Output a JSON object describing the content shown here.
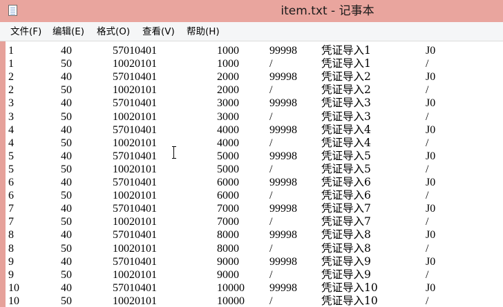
{
  "window": {
    "title": "item.txt - 记事本"
  },
  "menu": [
    "文件(F)",
    "编辑(E)",
    "格式(O)",
    "查看(V)",
    "帮助(H)"
  ],
  "rows": [
    [
      "1",
      "40",
      "57010401",
      "1000",
      "99998",
      "凭证导入1",
      "J0"
    ],
    [
      "1",
      "50",
      "10020101",
      "1000",
      "/",
      "凭证导入1",
      "/"
    ],
    [
      "2",
      "40",
      "57010401",
      "2000",
      "99998",
      "凭证导入2",
      "J0"
    ],
    [
      "2",
      "50",
      "10020101",
      "2000",
      "/",
      "凭证导入2",
      "/"
    ],
    [
      "3",
      "40",
      "57010401",
      "3000",
      "99998",
      "凭证导入3",
      "J0"
    ],
    [
      "3",
      "50",
      "10020101",
      "3000",
      "/",
      "凭证导入3",
      "/"
    ],
    [
      "4",
      "40",
      "57010401",
      "4000",
      "99998",
      "凭证导入4",
      "J0"
    ],
    [
      "4",
      "50",
      "10020101",
      "4000",
      "/",
      "凭证导入4",
      "/"
    ],
    [
      "5",
      "40",
      "57010401",
      "5000",
      "99998",
      "凭证导入5",
      "J0"
    ],
    [
      "5",
      "50",
      "10020101",
      "5000",
      "/",
      "凭证导入5",
      "/"
    ],
    [
      "6",
      "40",
      "57010401",
      "6000",
      "99998",
      "凭证导入6",
      "J0"
    ],
    [
      "6",
      "50",
      "10020101",
      "6000",
      "/",
      "凭证导入6",
      "/"
    ],
    [
      "7",
      "40",
      "57010401",
      "7000",
      "99998",
      "凭证导入7",
      "J0"
    ],
    [
      "7",
      "50",
      "10020101",
      "7000",
      "/",
      "凭证导入7",
      "/"
    ],
    [
      "8",
      "40",
      "57010401",
      "8000",
      "99998",
      "凭证导入8",
      "J0"
    ],
    [
      "8",
      "50",
      "10020101",
      "8000",
      "/",
      "凭证导入8",
      "/"
    ],
    [
      "9",
      "40",
      "57010401",
      "9000",
      "99998",
      "凭证导入9",
      "J0"
    ],
    [
      "9",
      "50",
      "10020101",
      "9000",
      "/",
      "凭证导入9",
      "/"
    ],
    [
      "10",
      "40",
      "57010401",
      "10000",
      "99998",
      "凭证导入10",
      "J0"
    ],
    [
      "10",
      "50",
      "10020101",
      "10000",
      "/",
      "凭证导入10",
      "/"
    ]
  ]
}
